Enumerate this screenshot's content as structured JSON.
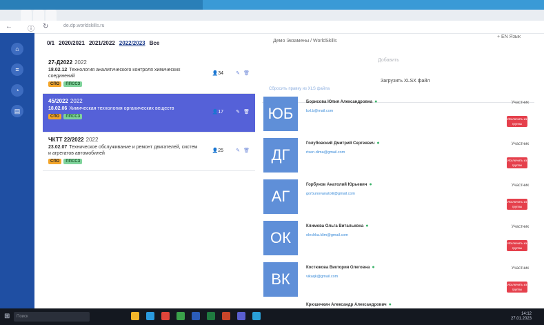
{
  "browser": {
    "tabs": [
      "",
      "",
      "",
      "",
      "",
      "",
      ""
    ],
    "url": "de.dp.worldskills.ru"
  },
  "header": {
    "years": [
      "0/1",
      "2020/2021",
      "2021/2022",
      "2022/2023",
      "Все"
    ],
    "active_year": "2022/2023",
    "title": "Демо Экзамены / WorldSkills",
    "lang": "+ EN Язык"
  },
  "groups": [
    {
      "code": "27-Д2022",
      "year": "2022",
      "spec_code": "18.02.12",
      "spec_name": "Технология аналитического контроля химических соединений",
      "badges": [
        "СПО",
        "ППССЗ"
      ],
      "count": "34",
      "selected": false
    },
    {
      "code": "45/2022",
      "year": "2022",
      "spec_code": "18.02.06",
      "spec_name": "Химическая технология органических веществ",
      "badges": [
        "СПО",
        "ППССЗ"
      ],
      "count": "17",
      "selected": true
    },
    {
      "code": "ЧКТТ 22/2022",
      "year": "2022",
      "spec_code": "23.02.07",
      "spec_name": "Техническое обслуживание и ремонт двигателей, систем и агрегатов автомобилей",
      "badges": [
        "СПО",
        "ППССЗ"
      ],
      "count": "25",
      "selected": false
    }
  ],
  "panel": {
    "upload_button": "Добавить",
    "upload_xls": "Загрузить XLSX файл",
    "check_rights": "Сбросить правку из XLS файла"
  },
  "members": [
    {
      "initials": "ЮБ",
      "name": "Борисова Юлия Александровна",
      "email": "bxl.b@mail.com",
      "role": "Участник",
      "remove": "Исключить из группы"
    },
    {
      "initials": "ДГ",
      "name": "Голубовский Дмитрий Сергеевич",
      "email": "rtsen.dima@gmail.com",
      "role": "Участник",
      "remove": "Исключить из группы"
    },
    {
      "initials": "АГ",
      "name": "Горбунов Анатолий Юрьевич",
      "email": "gorbunovanatolii@gmail.com",
      "role": "Участник",
      "remove": "Исключить из группы"
    },
    {
      "initials": "ОК",
      "name": "Климова Ольга Витальевна",
      "email": "olechka.klim@gmail.com",
      "role": "Участник",
      "remove": "Исключить из группы"
    },
    {
      "initials": "ВК",
      "name": "Костюкова Виктория Олеговна",
      "email": "vikaqk@gmail.com",
      "role": "Участник",
      "remove": "Исключить из группы"
    },
    {
      "initials": "",
      "name": "Крюшечкин Александр Александрович",
      "email": "",
      "role": "",
      "remove": ""
    }
  ],
  "taskbar": {
    "search": "Поиск",
    "time": "14:12",
    "date": "27.01.2023"
  },
  "colors": {
    "rail": "#1f4fa3",
    "selected_row": "#5561d8",
    "avatar": "#5f8fd8",
    "remove_button": "#e5404c",
    "badge_spo": "#f3a52a",
    "badge_ppssz": "#7fd39b"
  }
}
